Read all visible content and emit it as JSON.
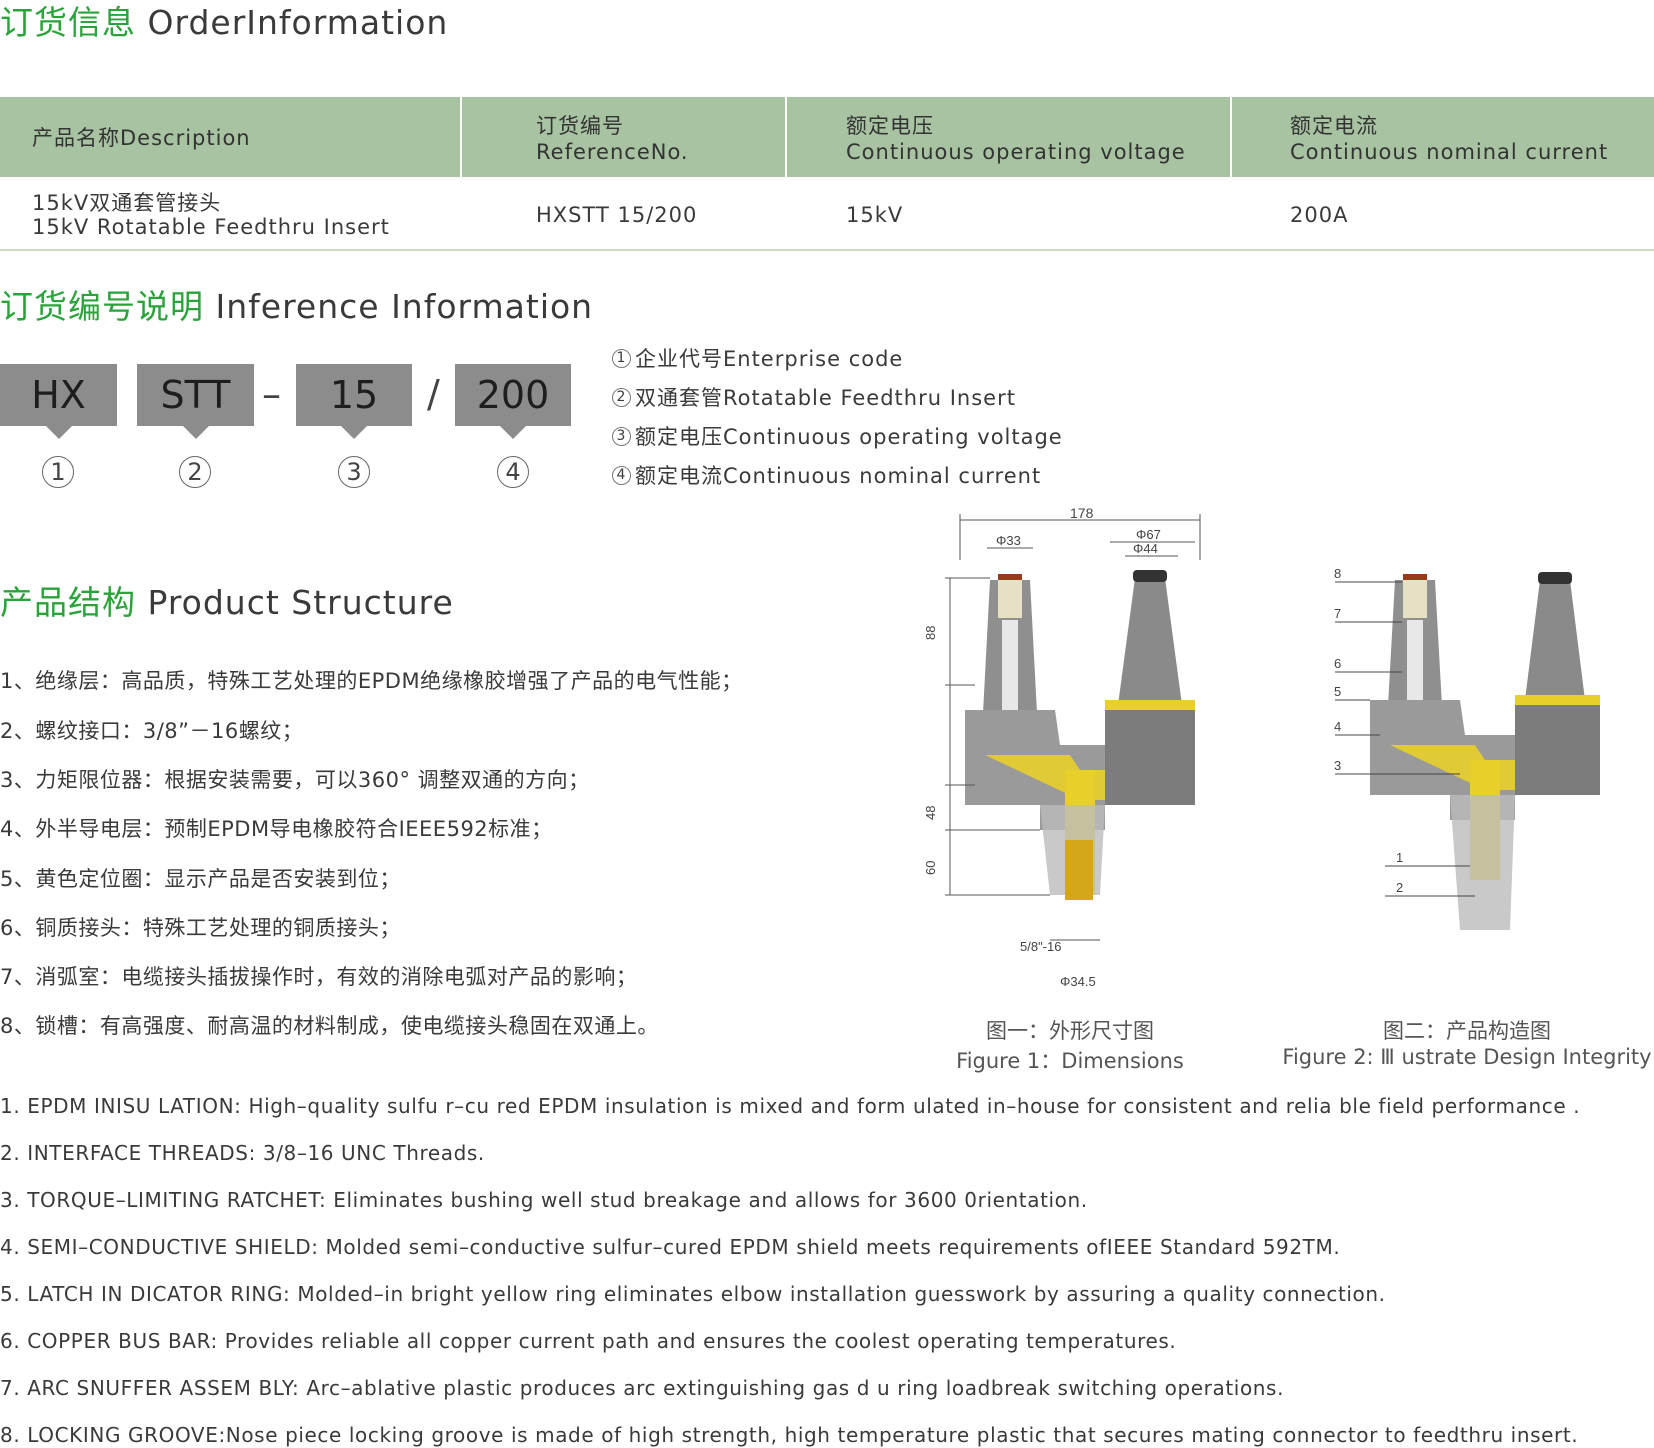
{
  "order": {
    "title_cn": "订货信息",
    "title_en": "OrderInformation",
    "headers": [
      {
        "cn": "产品名称Description",
        "en": ""
      },
      {
        "cn": "订货编号",
        "en": "ReferenceNo."
      },
      {
        "cn": "额定电压",
        "en": "Continuous operating voltage"
      },
      {
        "cn": "额定电流",
        "en": "Continuous nominal current"
      }
    ],
    "row": {
      "desc_cn": "15kV双通套管接头",
      "desc_en": "15kV Rotatable Feedthru Insert",
      "ref": "HXSTT 15/200",
      "voltage": "15kV",
      "current": "200A"
    }
  },
  "inference": {
    "title_cn": "订货编号说明",
    "title_en": "Inference Information",
    "codes": [
      "HX",
      "STT",
      "15",
      "200"
    ],
    "separators": [
      "–",
      "/"
    ],
    "numbers": [
      "1",
      "2",
      "3",
      "4"
    ],
    "legend": [
      {
        "num": "1",
        "text": "企业代号Enterprise code"
      },
      {
        "num": "2",
        "text": "双通套管Rotatable Feedthru Insert"
      },
      {
        "num": "3",
        "text": "额定电压Continuous operating voltage"
      },
      {
        "num": "4",
        "text": "额定电流Continuous nominal current"
      }
    ]
  },
  "structure": {
    "title_cn": "产品结构",
    "title_en": "Product Structure",
    "items_cn": [
      "1、绝缘层：高品质，特殊工艺处理的EPDM绝缘橡胶增强了产品的电气性能；",
      "2、螺纹接口：3/8”－16螺纹；",
      "3、力矩限位器：根据安装需要，可以360°  调整双通的方向；",
      "4、外半导电层：预制EPDM导电橡胶符合IEEE592标准；",
      "5、黄色定位圈：显示产品是否安装到位；",
      "6、铜质接头：特殊工艺处理的铜质接头；",
      "7、消弧室：电缆接头插拔操作时，有效的消除电弧对产品的影响；",
      "8、锁槽：有高强度、耐高温的材料制成，使电缆接头稳固在双通上。"
    ],
    "items_en": [
      "1. EPDM INISU LATION: High–quality sulfu r–cu red EPDM insulation is mixed and form ulated in–house for consistent and relia ble field performance .",
      "2. INTERFACE THREADS: 3/8–16 UNC Threads.",
      "3. TORQUE–LIMITING RATCHET: Eliminates bushing well stud breakage and allows for 3600 0rientation.",
      "4. SEMI–CONDUCTIVE SHIELD: Molded semi–conductive sulfur–cured EPDM shield meets requirements ofIEEE Standard 592TM.",
      "5. LATCH IN DICATOR RING: Molded–in bright yellow ring eliminates elbow installation guesswork by assuring a quality connection.",
      "6. COPPER BUS BAR: Provides reliable all copper current path and ensures the coolest operating temperatures.",
      "7. ARC SNUFFER ASSEM BLY: Arc–ablative plastic produces arc extinguishing gas d u ring loadbreak switching operations.",
      "8. LOCKING GROOVE:Nose piece locking groove is made of high strength, high temperature plastic that secures mating connector to feedthru insert."
    ]
  },
  "figure1": {
    "caption_cn": "图一：外形尺寸图",
    "caption_en": "Figure 1：Dimensions",
    "dims": [
      "178",
      "Φ33",
      "Φ67",
      "Φ44",
      "88",
      "48",
      "60",
      "5/8\"-16",
      "Φ34.5"
    ]
  },
  "figure2": {
    "caption_cn": "图二：产品构造图",
    "caption_en": "Figure 2: Ⅲ ustrate Design Integrity",
    "labels": [
      "8",
      "7",
      "6",
      "5",
      "4",
      "3",
      "1",
      "2"
    ]
  },
  "colors": {
    "accent_green": "#2aa33a",
    "header_green": "#a7c3a1",
    "code_gray": "#8c8c8c",
    "body_gray": "#8f8f8f",
    "yellow": "#e8cf2a"
  }
}
